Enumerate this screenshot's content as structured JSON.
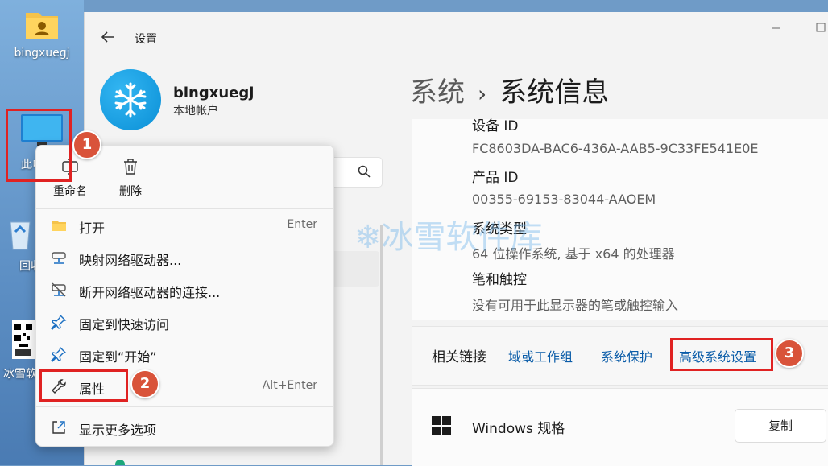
{
  "desktop": {
    "icons": [
      {
        "label": "bingxuegj",
        "icon": "user-folder-icon"
      },
      {
        "label": "此电脑",
        "icon": "monitor-icon"
      },
      {
        "label": "回收站",
        "icon": "recycle-bin-icon"
      },
      {
        "label": "冰雪软件库公众号",
        "icon": "qr-code-icon"
      }
    ]
  },
  "window": {
    "title": "设置",
    "back_icon": "back-arrow-icon",
    "controls": [
      "minimize-icon",
      "maximize-icon"
    ]
  },
  "account": {
    "name": "bingxuegj",
    "type": "本地帐户",
    "avatar_icon": "snowflake-icon"
  },
  "search": {
    "placeholder": "",
    "icon": "search-icon"
  },
  "breadcrumb": {
    "parent": "系统",
    "separator": "›",
    "current": "系统信息"
  },
  "specs": [
    {
      "label": "设备 ID",
      "value": "FC8603DA-BAC6-436A-AAB5-9C33FE541E0E"
    },
    {
      "label": "产品 ID",
      "value": "00355-69153-83044-AAOEM"
    },
    {
      "label": "系统类型",
      "value": "64 位操作系统, 基于 x64 的处理器"
    },
    {
      "label": "笔和触控",
      "value": "没有可用于此显示器的笔或触控输入"
    }
  ],
  "related": {
    "title": "相关链接",
    "links": [
      "域或工作组",
      "系统保护",
      "高级系统设置"
    ]
  },
  "windows_spec": {
    "title": "Windows 规格",
    "copy_button": "复制",
    "icon": "windows-logo-icon"
  },
  "context_menu": {
    "quick_actions": [
      {
        "label": "重命名",
        "icon": "rename-icon"
      },
      {
        "label": "删除",
        "icon": "trash-icon"
      }
    ],
    "items": [
      {
        "label": "打开",
        "shortcut": "Enter",
        "icon": "folder-icon"
      },
      {
        "label": "映射网络驱动器...",
        "shortcut": "",
        "icon": "network-drive-icon"
      },
      {
        "label": "断开网络驱动器的连接...",
        "shortcut": "",
        "icon": "disconnect-drive-icon"
      },
      {
        "label": "固定到快速访问",
        "shortcut": "",
        "icon": "pin-icon"
      },
      {
        "label": "固定到“开始”",
        "shortcut": "",
        "icon": "pin-start-icon"
      },
      {
        "label": "属性",
        "shortcut": "Alt+Enter",
        "icon": "wrench-icon"
      },
      {
        "label": "显示更多选项",
        "shortcut": "",
        "icon": "more-options-icon"
      }
    ]
  },
  "annotations": {
    "badges": [
      "1",
      "2",
      "3"
    ],
    "highlight_color": "#e02222",
    "badge_color": "#d9533a"
  },
  "watermark": "公众号：❄冰雪软件库"
}
